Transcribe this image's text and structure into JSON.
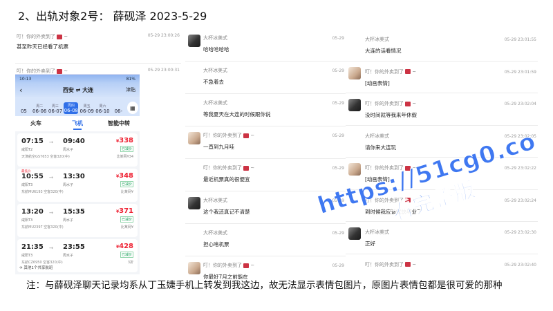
{
  "title": "2、出轨对象2号：  薛砚泽   2023-5-29",
  "left_messages": [
    {
      "name": "叮！你的外卖到了",
      "time": "05-29 23:00:26",
      "text": "甚至昨天已经看了机票"
    },
    {
      "name": "叮！你的外卖到了",
      "time": "05-29 23:00:31",
      "text": ""
    }
  ],
  "phone": {
    "status_time": "10:13",
    "status_right": "81%",
    "back": "‹",
    "route": "西安 ⇌ 大连",
    "header_right": "津贴",
    "dates": [
      {
        "wd": "",
        "d": "05"
      },
      {
        "wd": "周二",
        "d": "06-06"
      },
      {
        "wd": "周三",
        "d": "06-07"
      },
      {
        "wd": "周四",
        "d": "06-08",
        "selected": true
      },
      {
        "wd": "周五",
        "d": "06-09"
      },
      {
        "wd": "周六",
        "d": "06-10"
      },
      {
        "wd": "",
        "d": "06-"
      }
    ],
    "calendar_icon": "calendar-icon",
    "tabs": [
      "火车",
      "飞机",
      "智能中转"
    ],
    "active_tab": 1,
    "flights": [
      {
        "note": "",
        "dep": "07:15",
        "arr": "09:40",
        "dep_airport": "咸阳T2",
        "arr_airport": "周水子",
        "price": "338",
        "badge": "已减价",
        "info": "天津航空GS7653 空客320(中)",
        "count": "比某网¥34"
      },
      {
        "note": "最低价",
        "dep": "10:55",
        "arr": "13:30",
        "dep_airport": "咸阳T3",
        "arr_airport": "周水子",
        "price": "348",
        "badge": "已减价",
        "info": "东航MU6193 空客320(中)",
        "count": "比某网¥"
      },
      {
        "note": "",
        "dep": "13:20",
        "arr": "15:35",
        "dep_airport": "咸阳T3",
        "arr_airport": "周水子",
        "price": "371",
        "badge": "已减价",
        "info": "东航MU2397 空客320(中)",
        "count": "比某网¥"
      },
      {
        "note": "",
        "dep": "21:35",
        "arr": "23:55",
        "dep_airport": "咸阳T3",
        "arr_airport": "周水子",
        "price": "428",
        "badge": "已减价",
        "info": "东航CZ6950 空客320(中)",
        "count": "3折"
      }
    ],
    "footer": "✈ 其他1个共享航班"
  },
  "mid_messages": [
    {
      "name": "大杯冰美式",
      "time": "05-29",
      "text": "哈哈哈哈哈"
    },
    {
      "name": "大杯冰美式",
      "time": "05-29",
      "text": "不急着去"
    },
    {
      "name": "大杯冰美式",
      "time": "05-29",
      "text": "等我夏天在大连的时候跟你说"
    },
    {
      "name": "叮！你的外卖到了",
      "time": "05-29",
      "text": "一直到九月哇"
    },
    {
      "name": "叮！你的外卖到了",
      "time": "05-29",
      "text": "最近机票真的很便宜"
    },
    {
      "name": "大杯冰美式",
      "time": "05-29",
      "text": "这个我还真记不清楚"
    },
    {
      "name": "大杯冰美式",
      "time": "05-29",
      "text": "担心啥机票"
    },
    {
      "name": "叮！你的外卖到了",
      "time": "05-29",
      "text": "你最好7月之前能在"
    }
  ],
  "right_messages": [
    {
      "name": "大杯冰美式",
      "time": "05-29 23:01:55",
      "text": "大连的话看情况"
    },
    {
      "name": "叮！你的外卖到了",
      "time": "05-29 23:01:59",
      "text": "[动画表情]"
    },
    {
      "name": "叮！你的外卖到了",
      "time": "05-29 23:02:04",
      "text": "没时间就等我来年休假"
    },
    {
      "name": "大杯冰美式",
      "time": "05-29 23:02:05",
      "text": "请你来大连玩"
    },
    {
      "name": "叮！你的外卖到了",
      "time": "05-29 23:02:22",
      "text": "[动画表情]"
    },
    {
      "name": "叮！你的外卖到了",
      "time": "05-29 23:02:24",
      "text": "到时候我应该就快毕业了"
    },
    {
      "name": "大杯冰美式",
      "time": "05-29 23:02:30",
      "text": "正好"
    },
    {
      "name": "叮！你的外卖到了",
      "time": "05-29 23:02:40",
      "text": ""
    }
  ],
  "note": "注：与薛砚泽聊天记录均系从丁玉婕手机上转发到我这边，故无法显示表情包图片，原图片表情包都是很可爱的那种",
  "watermark": {
    "line1": "https://51cg0.co",
    "line2": "看完整版"
  }
}
